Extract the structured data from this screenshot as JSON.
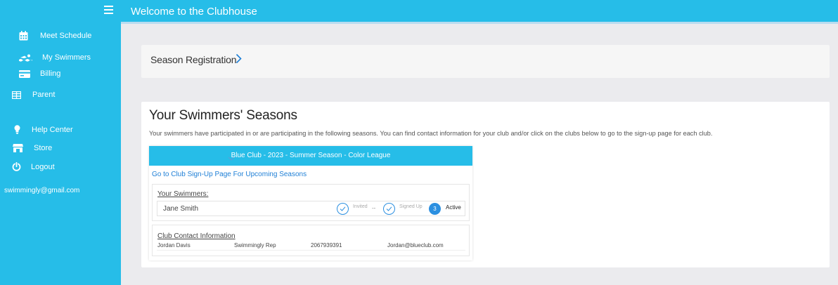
{
  "colors": {
    "accent": "#26bde8",
    "link": "#1e7fd6",
    "step": "#2b8fe0"
  },
  "header": {
    "title": "Welcome to the Clubhouse"
  },
  "sidebar": {
    "items": [
      {
        "label": "Meet Schedule",
        "icon": "calendar-icon"
      },
      {
        "label": "My Swimmers",
        "icon": "swimmer-icon"
      },
      {
        "label": "Billing",
        "icon": "credit-card-icon"
      },
      {
        "label": "Parent",
        "icon": "table-icon"
      },
      {
        "label": "Help Center",
        "icon": "lightbulb-icon"
      },
      {
        "label": "Store",
        "icon": "store-icon"
      },
      {
        "label": "Logout",
        "icon": "power-icon"
      }
    ],
    "email": "swimmingly@gmail.com"
  },
  "registration": {
    "label": "Season Registration"
  },
  "seasons": {
    "title": "Your Swimmers' Seasons",
    "description": "Your swimmers have participated in or are participating in the following seasons. You can find contact information for your club and/or click on the clubs below to go to the sign-up page for each club.",
    "club": {
      "title": "Blue Club - 2023 - Summer Season - Color League",
      "signup_link": "Go to Club Sign-Up Page For Upcoming Seasons",
      "swimmers_label": "Your Swimmers:",
      "swimmers": [
        {
          "name": "Jane Smith",
          "step1": "Invited",
          "step2": "Signed Up",
          "step3_num": "3",
          "step3": "Active",
          "dash": "--"
        }
      ],
      "contact_label": "Club Contact Information",
      "contact": {
        "name": "Jordan Davis",
        "role": "Swimmingly Rep",
        "phone": "2067939391",
        "email": "Jordan@blueclub.com"
      }
    }
  }
}
